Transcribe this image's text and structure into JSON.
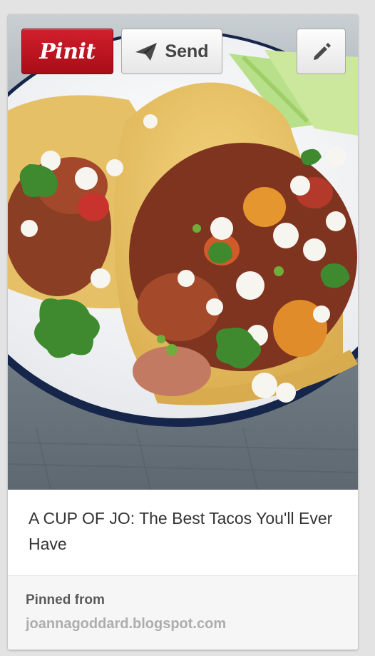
{
  "pin": {
    "pin_it_label": "Pinit",
    "send_label": "Send",
    "title": "A CUP OF JO: The Best Tacos You'll Ever Have",
    "pinned_from_label": "Pinned from",
    "source_domain": "joannagoddard.blogspot.com",
    "brand_color": "#cb2027"
  },
  "icons": {
    "send": "paper-plane-icon",
    "edit": "pencil-icon"
  }
}
